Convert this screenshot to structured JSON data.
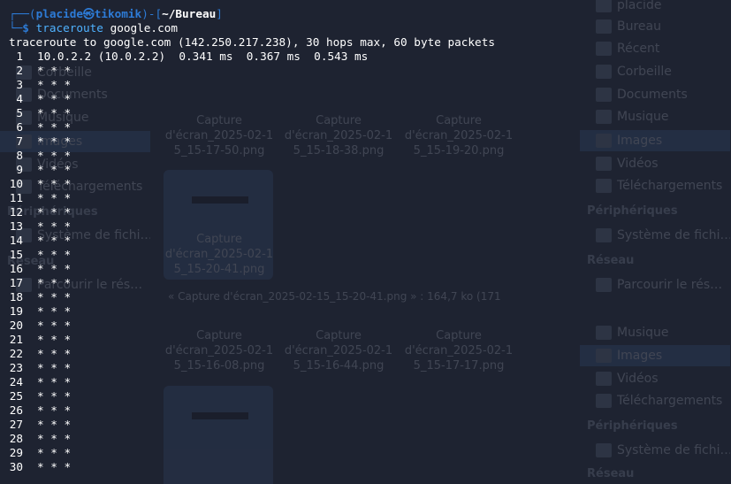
{
  "window": {
    "background": "#1e2331"
  },
  "background_filemanager": {
    "left_sidebar": [
      {
        "label": "Corbeille",
        "y": "ghost"
      },
      {
        "label": "Documents",
        "y": "ghost"
      },
      {
        "label": "Musique",
        "y": "ghost"
      },
      {
        "label": "Images",
        "y": "ghost"
      },
      {
        "label": "Vidéos",
        "y": "ghost"
      },
      {
        "label": "Téléchargements",
        "y": "ghost"
      },
      {
        "label": "Périphériques",
        "y": "ghost"
      },
      {
        "label": "Système de fichi…",
        "y": "ghost"
      },
      {
        "label": "Réseau",
        "y": "ghost"
      },
      {
        "label": "Parcourir le rés…",
        "y": "ghost"
      }
    ],
    "right_sidebar": [
      {
        "label": "placide"
      },
      {
        "label": "Bureau"
      },
      {
        "label": "Récent"
      },
      {
        "label": "Corbeille"
      },
      {
        "label": "Documents"
      },
      {
        "label": "Musique"
      },
      {
        "label": "Images"
      },
      {
        "label": "Vidéos"
      },
      {
        "label": "Téléchargements"
      },
      {
        "label": "Périphériques"
      },
      {
        "label": "Système de fichi…"
      },
      {
        "label": "Réseau"
      },
      {
        "label": "Parcourir le rés…"
      },
      {
        "label": "Musique"
      },
      {
        "label": "Images"
      },
      {
        "label": "Vidéos"
      },
      {
        "label": "Téléchargements"
      },
      {
        "label": "Périphériques"
      },
      {
        "label": "Système de fichi…"
      },
      {
        "label": "Réseau"
      }
    ],
    "files": [
      {
        "line1": "Capture",
        "line2": "d'écran_2025-02-1",
        "line3": "5_15-17-50.png"
      },
      {
        "line1": "Capture",
        "line2": "d'écran_2025-02-1",
        "line3": "5_15-18-38.png"
      },
      {
        "line1": "Capture",
        "line2": "d'écran_2025-02-1",
        "line3": "5_15-19-20.png"
      },
      {
        "line1": "Capture",
        "line2": "d'écran_2025-02-1",
        "line3": "5_15-20-41.png"
      },
      {
        "line1": "Capture",
        "line2": "d'écran_2025-02-1",
        "line3": "5_15-16-08.png"
      },
      {
        "line1": "Capture",
        "line2": "d'écran_2025-02-1",
        "line3": "5_15-16-44.png"
      },
      {
        "line1": "Capture",
        "line2": "d'écran_2025-02-1",
        "line3": "5_15-17-17.png"
      }
    ],
    "status": "« Capture d'écran_2025-02-15_15-20-41.png » : 164,7 ko (171"
  },
  "terminal": {
    "prompt": {
      "corner_top": "┌──(",
      "user_host": "placide㉿tikomik",
      "separator": ")-[",
      "cwd": "~/Bureau",
      "close": "]",
      "corner_bottom": "└─",
      "dollar": "$",
      "command": "traceroute",
      "argument": "google.com"
    },
    "header": "traceroute to google.com (142.250.217.238), 30 hops max, 60 byte packets",
    "hops": [
      {
        "n": "1",
        "text": "10.0.2.2 (10.0.2.2)  0.341 ms  0.367 ms  0.543 ms"
      },
      {
        "n": "2",
        "text": "* * *"
      },
      {
        "n": "3",
        "text": "* * *"
      },
      {
        "n": "4",
        "text": "* * *"
      },
      {
        "n": "5",
        "text": "* * *"
      },
      {
        "n": "6",
        "text": "* * *"
      },
      {
        "n": "7",
        "text": "* * *"
      },
      {
        "n": "8",
        "text": "* * *"
      },
      {
        "n": "9",
        "text": "* * *"
      },
      {
        "n": "10",
        "text": "* * *"
      },
      {
        "n": "11",
        "text": "* * *"
      },
      {
        "n": "12",
        "text": "* * *"
      },
      {
        "n": "13",
        "text": "* * *"
      },
      {
        "n": "14",
        "text": "* * *"
      },
      {
        "n": "15",
        "text": "* * *"
      },
      {
        "n": "16",
        "text": "* * *"
      },
      {
        "n": "17",
        "text": "* * *"
      },
      {
        "n": "18",
        "text": "* * *"
      },
      {
        "n": "19",
        "text": "* * *"
      },
      {
        "n": "20",
        "text": "* * *"
      },
      {
        "n": "21",
        "text": "* * *"
      },
      {
        "n": "22",
        "text": "* * *"
      },
      {
        "n": "23",
        "text": "* * *"
      },
      {
        "n": "24",
        "text": "* * *"
      },
      {
        "n": "25",
        "text": "* * *"
      },
      {
        "n": "26",
        "text": "* * *"
      },
      {
        "n": "27",
        "text": "* * *"
      },
      {
        "n": "28",
        "text": "* * *"
      },
      {
        "n": "29",
        "text": "* * *"
      },
      {
        "n": "30",
        "text": "* * *"
      }
    ],
    "colors": {
      "prompt_blue": "#2d7bd6",
      "command_blue": "#4fb2ff",
      "text": "#ffffff"
    }
  }
}
